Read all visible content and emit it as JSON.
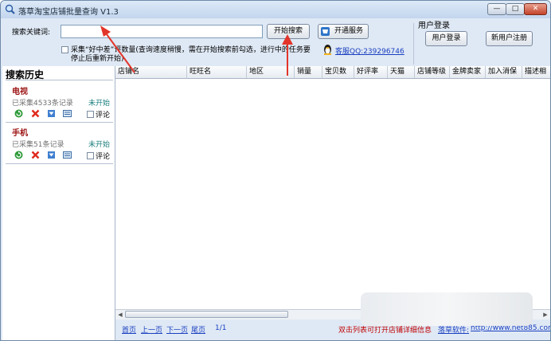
{
  "window": {
    "title": "落草淘宝店铺批量查询 V1.3",
    "controls": {
      "minimize": "—",
      "maximize": "□",
      "close": "✕"
    }
  },
  "search": {
    "label": "搜索关键词:",
    "value": "",
    "start_button": "开始搜索",
    "service_button": "开通服务",
    "option_line1": "采集“好中差”评数量(查询速度稍慢，需在开始搜索前勾选，进行中的任务要",
    "option_line2": "停止后重新开始)",
    "support_text": "客服QQ:239296746"
  },
  "login": {
    "group_title": "用户登录",
    "login_button": "用户登录",
    "register_button": "新用户注册"
  },
  "history": {
    "title": "搜索历史",
    "items": [
      {
        "keyword": "电视",
        "count": "已采集4533条记录",
        "status": "未开始",
        "comment_label": "评论"
      },
      {
        "keyword": "手机",
        "count": "已采集51条记录",
        "status": "未开始",
        "comment_label": "评论"
      }
    ]
  },
  "grid": {
    "columns": [
      "店铺名",
      "旺旺名",
      "地区",
      "销量",
      "宝贝数",
      "好评率",
      "天猫",
      "店铺等级",
      "金牌卖家",
      "加入消保",
      "描述相"
    ]
  },
  "footer": {
    "first": "首页",
    "prev": "上一页",
    "next": "下一页",
    "last": "尾页",
    "page": "1/1",
    "hint": "双击列表可打开店铺详细信息",
    "software_label": "落草软件:",
    "url": "http://www.net885.com/"
  },
  "colors": {
    "hint": "#c00000",
    "link": "#1a3fc0",
    "keyword": "#9b1010",
    "status": "#1b7e7e",
    "arrow": "#e2352a"
  }
}
